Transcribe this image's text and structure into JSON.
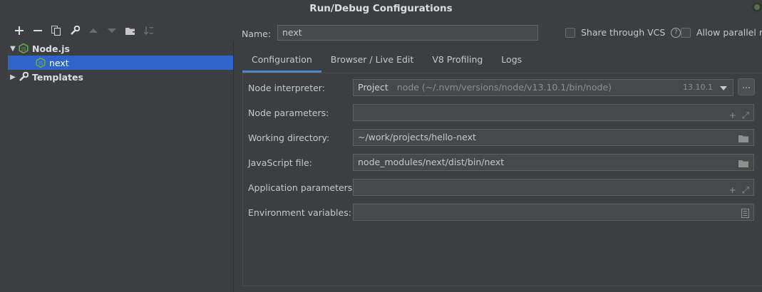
{
  "window": {
    "title": "Run/Debug Configurations"
  },
  "toolbar": {
    "buttons": [
      "add-icon",
      "remove-icon",
      "copy-icon",
      "wrench-icon",
      "move-up-icon",
      "move-down-icon",
      "folder-add-icon",
      "sort-icon"
    ]
  },
  "tree": {
    "items": [
      {
        "label": "Node.js",
        "icon": "nodejs-icon",
        "expanded": true
      },
      {
        "label": "next",
        "icon": "nodejs-icon",
        "selected": true
      },
      {
        "label": "Templates",
        "icon": "wrench-icon",
        "expanded": false
      }
    ]
  },
  "header": {
    "name_label": "Name:",
    "name_value": "next",
    "share_label": "Share through VCS",
    "help": "?",
    "parallel_label": "Allow parallel run"
  },
  "tabs": [
    {
      "label": "Configuration",
      "active": true
    },
    {
      "label": "Browser / Live Edit"
    },
    {
      "label": "V8 Profiling"
    },
    {
      "label": "Logs"
    }
  ],
  "form": {
    "interpreter": {
      "label": "Node interpreter:",
      "project": "Project",
      "path": "node (~/.nvm/versions/node/v13.10.1/bin/node)",
      "version": "13.10.1",
      "browse": "..."
    },
    "node_params": {
      "label": "Node parameters:",
      "value": ""
    },
    "working_dir": {
      "label": "Working directory:",
      "value": "~/work/projects/hello-next"
    },
    "js_file": {
      "label": "JavaScript file:",
      "value": "node_modules/next/dist/bin/next"
    },
    "app_params": {
      "label": "Application parameters:",
      "value": ""
    },
    "env_vars": {
      "label": "Environment variables:",
      "value": ""
    }
  },
  "colors": {
    "accent": "#2f65ca",
    "tab_underline": "#4a88c7",
    "background": "#3c3f41"
  }
}
